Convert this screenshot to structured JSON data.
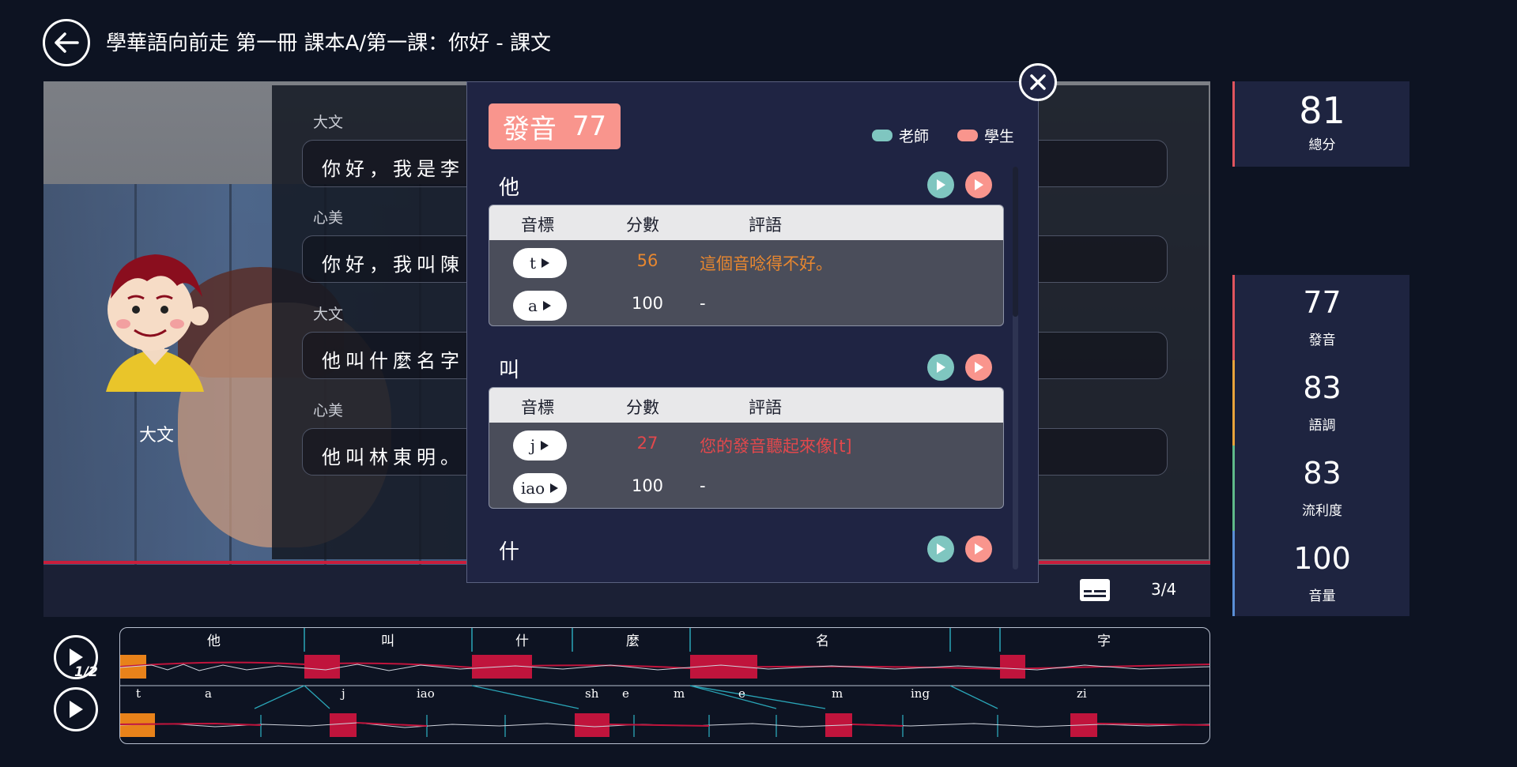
{
  "header": {
    "title": "學華語向前走 第一冊 課本A/第一課：你好 - 課文"
  },
  "lesson": {
    "rows": [
      {
        "speaker": "大文",
        "text": "你好，我是李"
      },
      {
        "speaker": "心美",
        "text": "你好，我叫陳"
      },
      {
        "speaker": "大文",
        "text": "他叫什麼名字"
      },
      {
        "speaker": "心美",
        "text": "他叫林東明。"
      }
    ],
    "avatar_name": "大文",
    "page_indicator": "3/4"
  },
  "scores": [
    {
      "value": "81",
      "label": "總分",
      "color": "#e0545e"
    },
    {
      "value": "77",
      "label": "發音",
      "color": "#e0545e"
    },
    {
      "value": "83",
      "label": "語調",
      "color": "#e8a33b"
    },
    {
      "value": "83",
      "label": "流利度",
      "color": "#5fb98a"
    },
    {
      "value": "100",
      "label": "音量",
      "color": "#5a8fd6"
    }
  ],
  "popup": {
    "badge_label": "發音",
    "badge_score": "77",
    "legend_teacher": "老師",
    "legend_student": "學生",
    "col_phonetic": "音標",
    "col_score": "分數",
    "col_comment": "評語",
    "words": [
      {
        "char": "他",
        "phonemes": [
          {
            "symbol": "t",
            "score": "56",
            "comment": "這個音唸得不好。",
            "color": "#e8872f"
          },
          {
            "symbol": "a",
            "score": "100",
            "comment": "-",
            "color": "#ffffff"
          }
        ]
      },
      {
        "char": "叫",
        "phonemes": [
          {
            "symbol": "j",
            "score": "27",
            "comment": "您的發音聽起來像[t]",
            "color": "#e2484c"
          },
          {
            "symbol": "iao",
            "score": "100",
            "comment": "-",
            "color": "#ffffff"
          }
        ]
      },
      {
        "char": "什",
        "phonemes": []
      }
    ],
    "colors": {
      "teacher": "#7fc6c0",
      "student": "#f9958d"
    }
  },
  "waveform": {
    "speed_label": "1/2",
    "word_labels": [
      "他",
      "叫",
      "什",
      "麼",
      "名",
      "字"
    ],
    "phoneme_labels": [
      "t",
      "a",
      "j",
      "iao",
      "sh",
      "e",
      "m",
      "e",
      "m",
      "ing",
      "zi"
    ]
  },
  "icons": {
    "back": "arrow-left-icon",
    "close": "close-icon",
    "subtitle": "subtitle-icon",
    "play": "play-icon"
  }
}
